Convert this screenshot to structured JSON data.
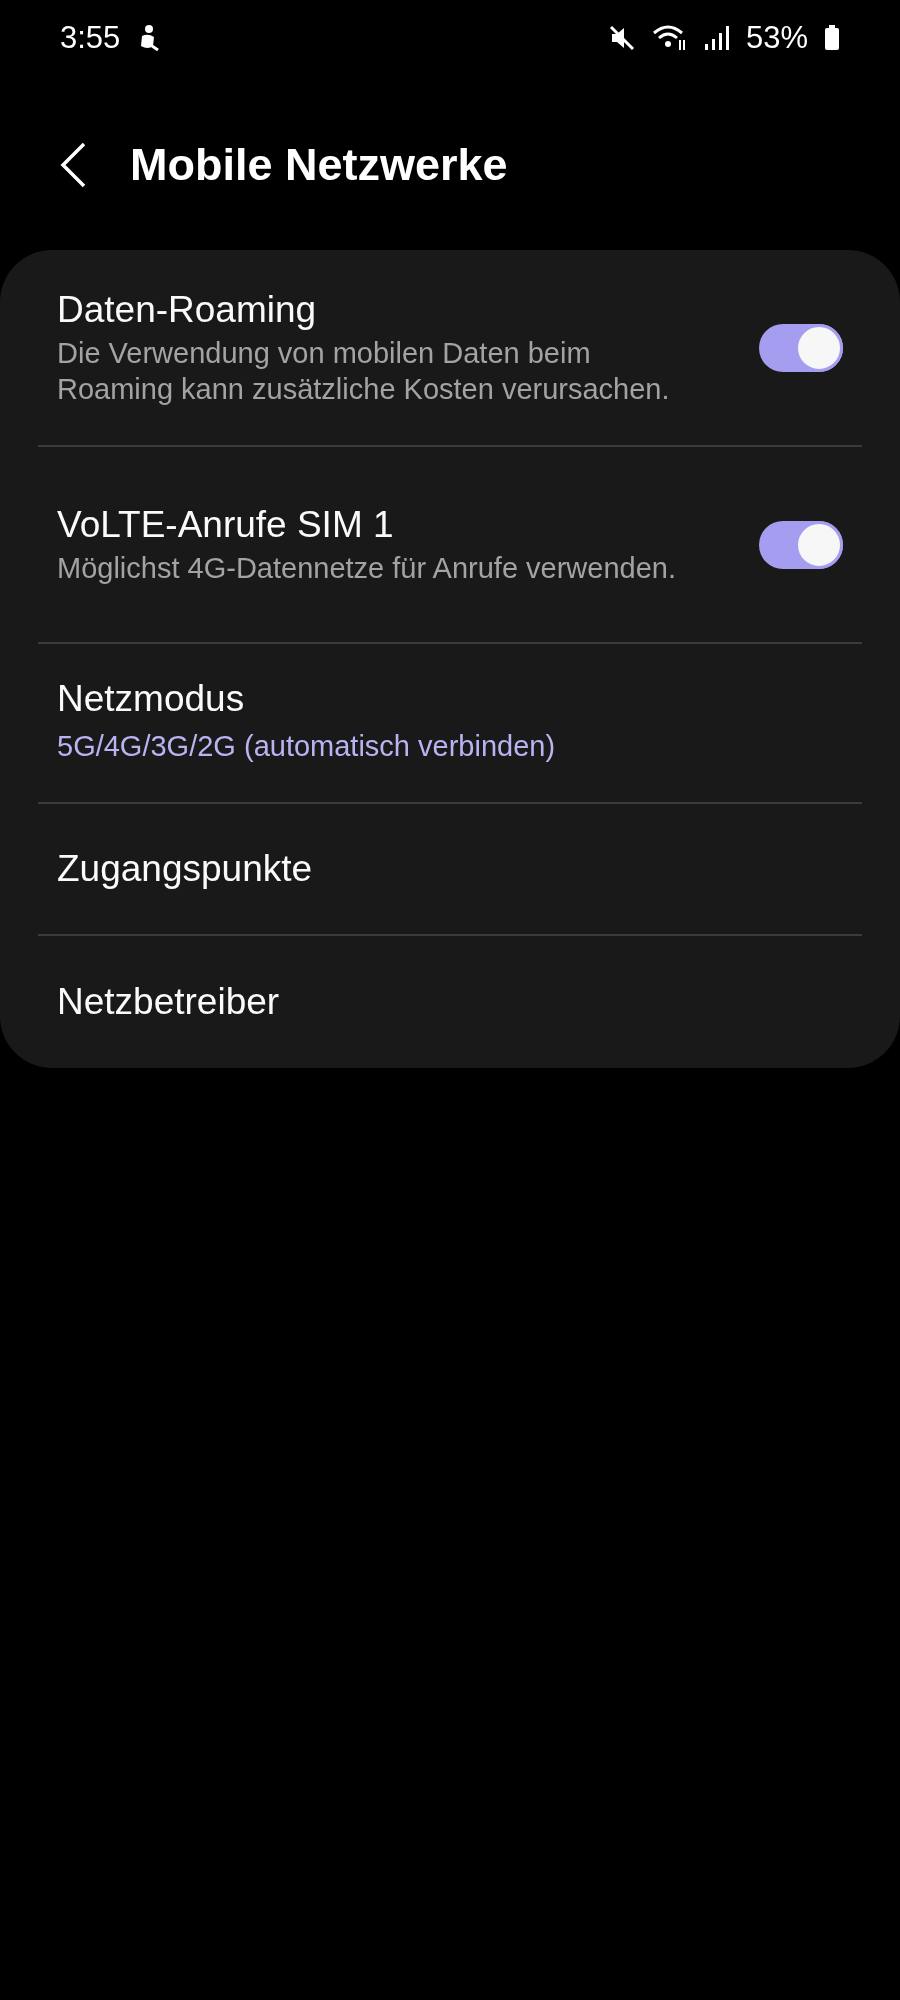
{
  "status_bar": {
    "time": "3:55",
    "battery": "53%"
  },
  "header": {
    "title": "Mobile Netzwerke"
  },
  "settings": [
    {
      "kind": "toggle",
      "title": "Daten-Roaming",
      "description": "Die Verwendung von mobilen Daten beim Roaming kann zusätzliche Kosten verursachen.",
      "on": true
    },
    {
      "kind": "toggle",
      "title": "VoLTE-Anrufe SIM 1",
      "description": "Möglichst 4G-Datennetze für Anrufe verwenden.",
      "on": true
    },
    {
      "kind": "value",
      "title": "Netzmodus",
      "value": "5G/4G/3G/2G (automatisch verbinden)"
    },
    {
      "kind": "plain",
      "title": "Zugangspunkte"
    },
    {
      "kind": "plain",
      "title": "Netzbetreiber"
    }
  ]
}
